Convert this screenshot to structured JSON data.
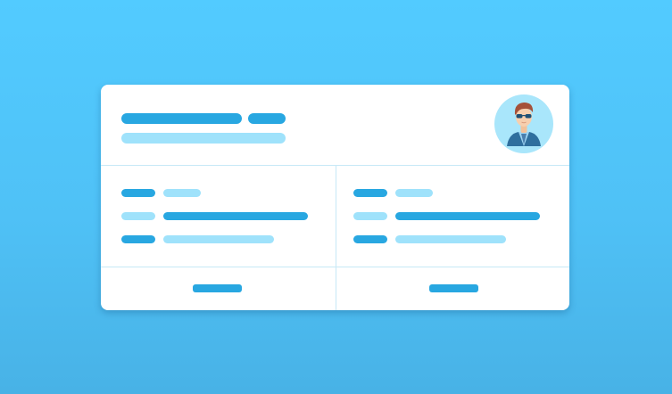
{
  "profile_card": {
    "avatar_icon": "user-avatar-icon",
    "colors": {
      "accent": "#28a7e1",
      "accent_light": "#9fe2fb",
      "background": "#4fc1f6",
      "card": "#ffffff",
      "divider": "#c7e9f6"
    }
  }
}
